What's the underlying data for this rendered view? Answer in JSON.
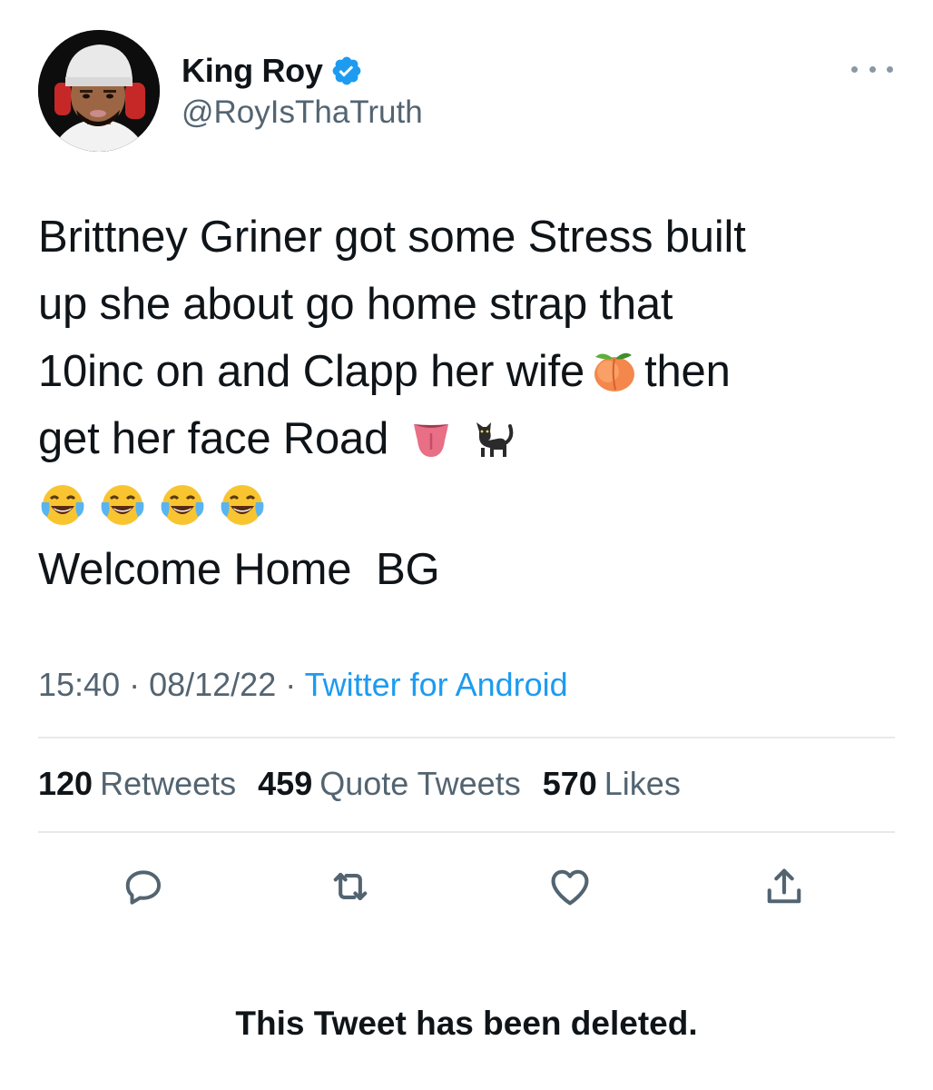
{
  "author": {
    "display_name": "King Roy",
    "handle": "@RoyIsThaTruth",
    "verified_icon": "verified-badge-icon"
  },
  "tweet": {
    "lines": {
      "line1": "Brittney Griner got some Stress built",
      "line2": "up she about go home strap that",
      "line3a": "10inc on and Clapp her wife",
      "line3b": "then",
      "line4": "get her face Road",
      "line6": "Welcome Home  BG"
    },
    "emojis": [
      "peach",
      "tongue",
      "black-cat",
      "face-with-tears-of-joy",
      "face-with-tears-of-joy",
      "face-with-tears-of-joy",
      "face-with-tears-of-joy"
    ]
  },
  "meta": {
    "time": "15:40",
    "separator": " · ",
    "date": "08/12/22",
    "source": "Twitter for Android"
  },
  "stats": {
    "retweets_count": "120",
    "retweets_label": "Retweets",
    "quotes_count": "459",
    "quotes_label": "Quote Tweets",
    "likes_count": "570",
    "likes_label": "Likes"
  },
  "actions": [
    "reply-icon",
    "retweet-icon",
    "like-icon",
    "share-icon"
  ],
  "notice": "This Tweet has been deleted.",
  "colors": {
    "accent": "#1d9bf0",
    "text": "#0f1419",
    "secondary": "#536471",
    "divider": "#e6e9eb"
  }
}
